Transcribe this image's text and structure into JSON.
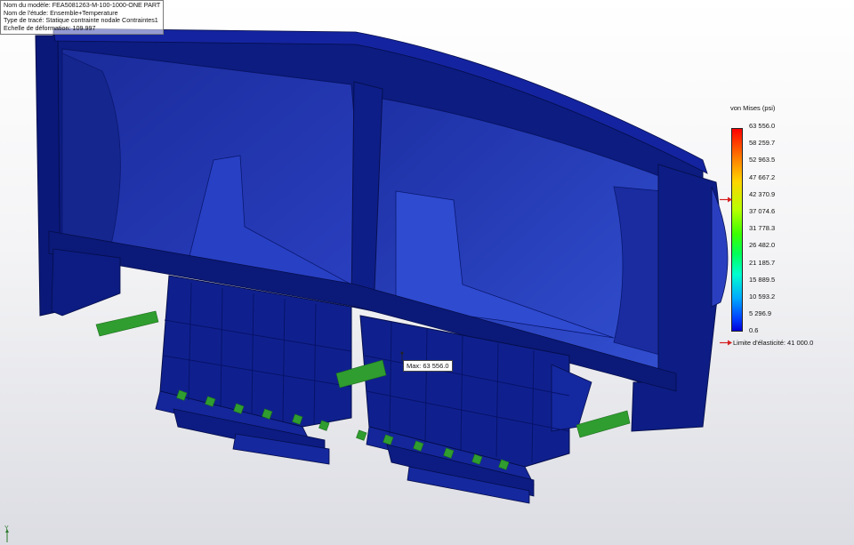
{
  "info": {
    "model_name": "Nom du modèle: FEA5081263-M-100-1000-ONE PART",
    "study_name": "Nom de l'étude: Ensemble+Temperature",
    "plot_type": "Type de tracé: Statique contrainte nodale Contraintes1",
    "deformation_scale": "Echelle de déformation: 109.997"
  },
  "legend": {
    "title": "von Mises (psi)",
    "ticks": [
      "63 556.0",
      "58 259.7",
      "52 963.5",
      "47 667.2",
      "42 370.9",
      "37 074.6",
      "31 778.3",
      "26 482.0",
      "21 185.7",
      "15 889.5",
      "10 593.2",
      "5 296.9",
      "0.6"
    ],
    "yield_limit": "Limite d'élasticité: 41 000.0",
    "max_value": 63556.0,
    "yield_value": 41000.0
  },
  "max_annotation": "Max: 63 556.0",
  "axis": {
    "y_label": "Y"
  },
  "colors": {
    "mesh_dark": "#0b1a78",
    "mesh_mid": "#1a2fa8",
    "mesh_light": "#2c44c9",
    "fixture_green": "#2f9d2f",
    "yield_arrow": "#d62020"
  }
}
